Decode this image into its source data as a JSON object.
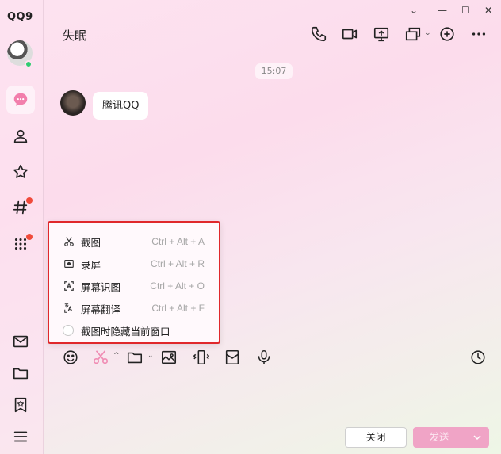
{
  "app": {
    "logo": "QQ9"
  },
  "window": {
    "minimize": "—",
    "maximize": "☐",
    "close": "✕",
    "collapse": "⌄"
  },
  "chat": {
    "title": "失眠",
    "timestamp": "15:07",
    "messages": [
      {
        "text": "腾讯QQ"
      }
    ]
  },
  "popup_menu": {
    "items": [
      {
        "icon": "scissors-icon",
        "label": "截图",
        "shortcut": "Ctrl + Alt + A"
      },
      {
        "icon": "screen-record-icon",
        "label": "录屏",
        "shortcut": "Ctrl + Alt + R"
      },
      {
        "icon": "text-recognize-icon",
        "label": "屏幕识图",
        "shortcut": "Ctrl + Alt + O"
      },
      {
        "icon": "translate-icon",
        "label": "屏幕翻译",
        "shortcut": "Ctrl + Alt + F"
      }
    ],
    "option_label": "截图时隐藏当前窗口"
  },
  "footer": {
    "close_label": "关闭",
    "send_label": "发送"
  },
  "colors": {
    "highlight_border": "#e0282b",
    "send_button": "#f0a4c6",
    "badge": "#f04a3a",
    "online": "#2ecc71"
  }
}
